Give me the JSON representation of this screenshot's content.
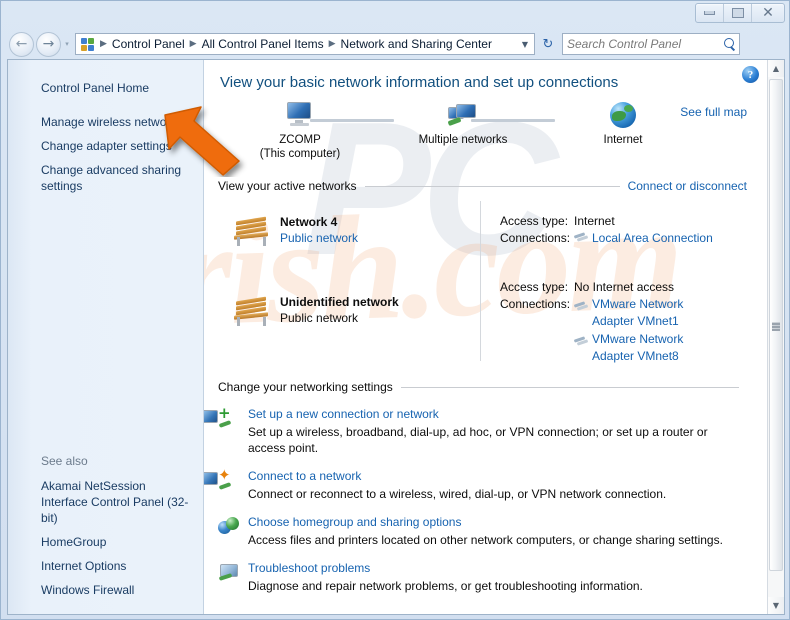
{
  "window": {
    "minimize_label": "Minimize",
    "maximize_label": "Restore",
    "close_label": "Close",
    "close_glyph": "✕",
    "back_glyph": "←",
    "forward_glyph": "→",
    "nav_dropdown_glyph": "▾"
  },
  "address_bar": {
    "icon": "control-panel-icon",
    "breadcrumbs": [
      "Control Panel",
      "All Control Panel Items",
      "Network and Sharing Center"
    ],
    "separator": "▶",
    "dropdown_glyph": "▼",
    "refresh_glyph": "↻",
    "search_placeholder": "Search Control Panel",
    "search_value": ""
  },
  "sidebar": {
    "home_label": "Control Panel Home",
    "items": [
      {
        "label": "Manage wireless networks"
      },
      {
        "label": "Change adapter settings"
      },
      {
        "label": "Change advanced sharing settings"
      }
    ],
    "see_also_label": "See also",
    "see_also_items": [
      {
        "label": "Akamai NetSession Interface Control Panel (32-bit)"
      },
      {
        "label": "HomeGroup"
      },
      {
        "label": "Internet Options"
      },
      {
        "label": "Windows Firewall"
      }
    ]
  },
  "main": {
    "help_glyph": "?",
    "page_title": "View your basic network information and set up connections",
    "watermark": "rish.com",
    "watermark2": "PC",
    "network_map": {
      "see_full_map": "See full map",
      "nodes": [
        {
          "name": "ZCOMP",
          "sub": "(This computer)",
          "icon": "computer-monitor-icon"
        },
        {
          "name": "Multiple networks",
          "sub": "",
          "icon": "multiple-networks-icon"
        },
        {
          "name": "Internet",
          "sub": "",
          "icon": "globe-icon"
        }
      ]
    },
    "active_networks": {
      "heading": "View your active networks",
      "right_link": "Connect or disconnect",
      "networks": [
        {
          "name": "Network  4",
          "type": "Public network",
          "access_label": "Access type:",
          "access_value": "Internet",
          "connections_label": "Connections:",
          "connections": [
            "Local Area Connection"
          ]
        },
        {
          "name": "Unidentified network",
          "type": "Public network",
          "access_label": "Access type:",
          "access_value": "No Internet access",
          "connections_label": "Connections:",
          "connections": [
            "VMware Network Adapter VMnet1",
            "VMware Network Adapter VMnet8"
          ]
        }
      ]
    },
    "change_settings": {
      "heading": "Change your networking settings",
      "items": [
        {
          "icon": "new-connection-icon",
          "title": "Set up a new connection or network",
          "desc": "Set up a wireless, broadband, dial-up, ad hoc, or VPN connection; or set up a router or access point."
        },
        {
          "icon": "connect-network-icon",
          "title": "Connect to a network",
          "desc": "Connect or reconnect to a wireless, wired, dial-up, or VPN network connection."
        },
        {
          "icon": "homegroup-icon",
          "title": "Choose homegroup and sharing options",
          "desc": "Access files and printers located on other network computers, or change sharing settings."
        },
        {
          "icon": "troubleshoot-icon",
          "title": "Troubleshoot problems",
          "desc": "Diagnose and repair network problems, or get troubleshooting information."
        }
      ]
    }
  },
  "scrollbar": {
    "up_glyph": "▲",
    "down_glyph": "▼"
  },
  "colors": {
    "link": "#1763b0",
    "title": "#12507f",
    "cursor": "#ef6c10",
    "sidebar_bg": "#eaf2fa"
  }
}
